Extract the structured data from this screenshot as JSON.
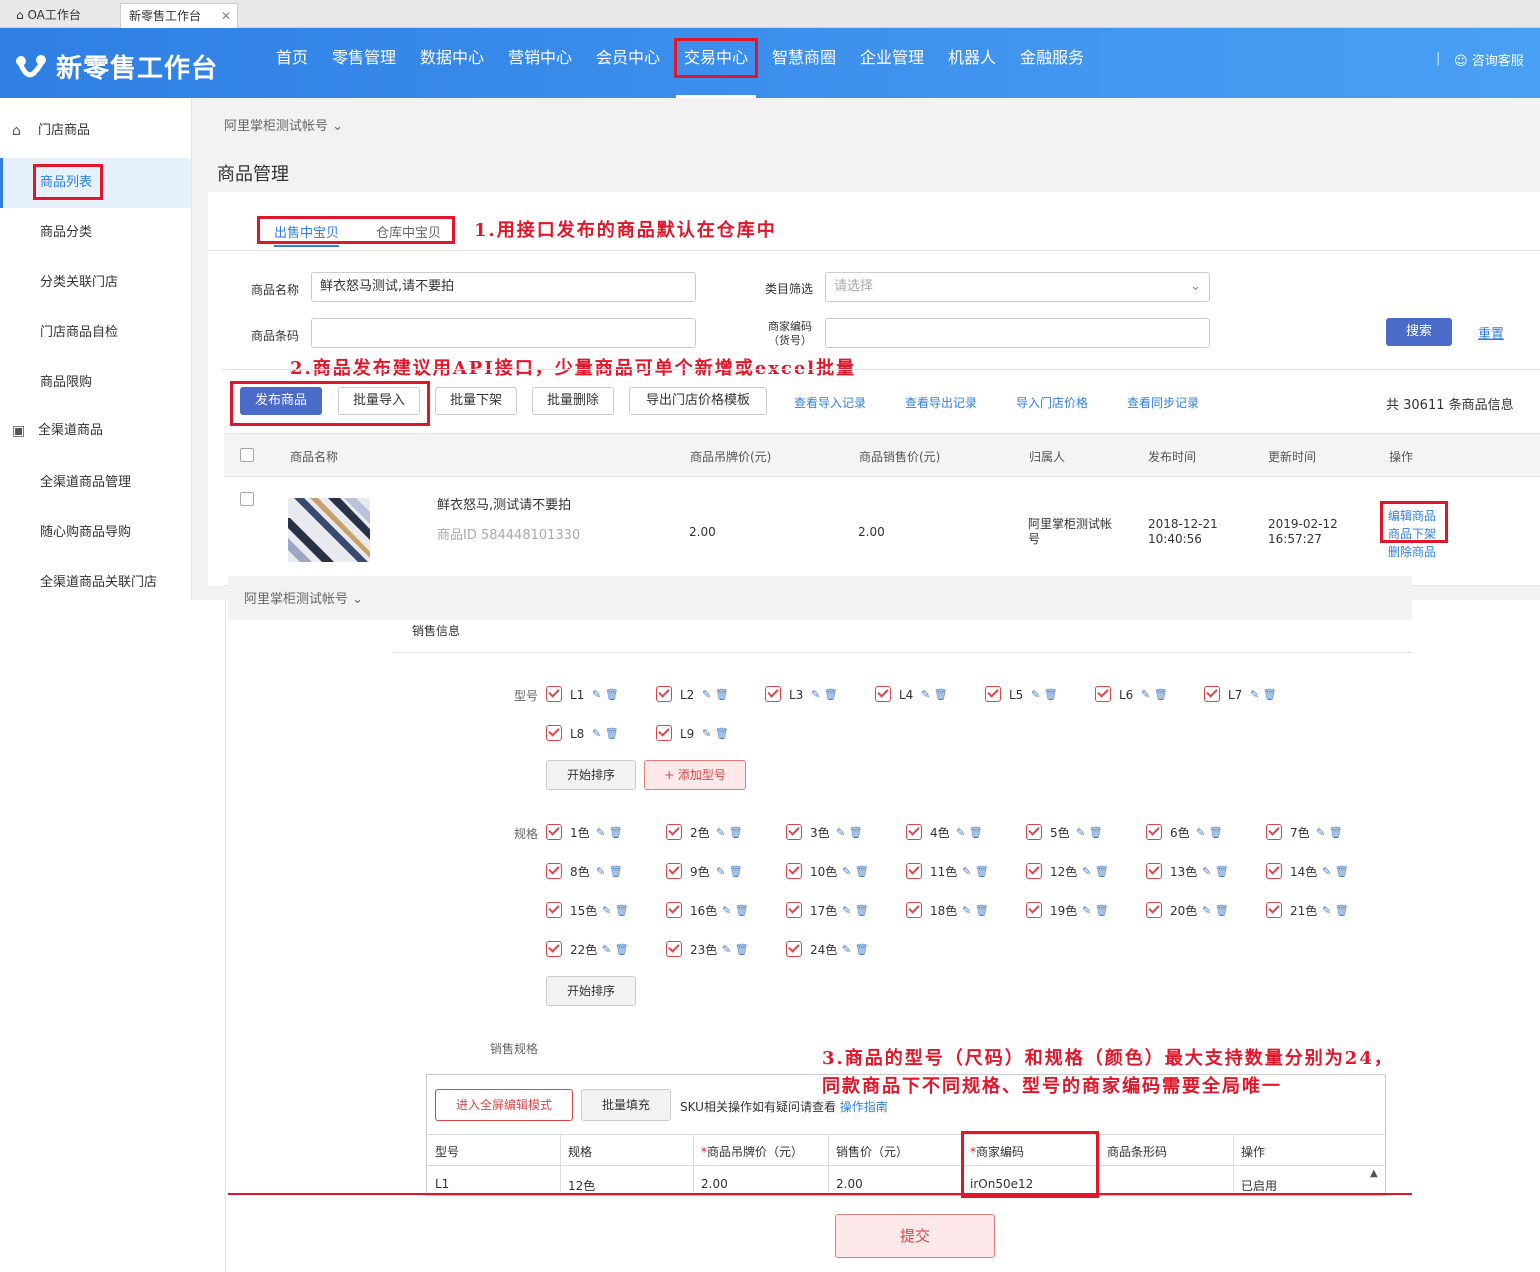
{
  "browser_tabs": [
    {
      "label": "OA工作台"
    },
    {
      "label": "新零售工作台"
    }
  ],
  "header": {
    "logo": "新零售工作台",
    "nav": [
      "首页",
      "零售管理",
      "数据中心",
      "营销中心",
      "会员中心",
      "交易中心",
      "智慧商圈",
      "企业管理",
      "机器人",
      "金融服务"
    ],
    "service": "咨询客服"
  },
  "sidebar": {
    "group1": "门店商品",
    "items1": [
      "商品列表",
      "商品分类",
      "分类关联门店",
      "门店商品自检",
      "商品限购"
    ],
    "group2": "全渠道商品",
    "items2": [
      "全渠道商品管理",
      "随心购商品导购",
      "全渠道商品关联门店"
    ]
  },
  "account": "阿里掌柜测试帐号",
  "page_title": "商品管理",
  "tabs": {
    "selling": "出售中宝贝",
    "warehouse": "仓库中宝贝"
  },
  "annotations": {
    "a1": "1.用接口发布的商品默认在仓库中",
    "a2": "2.商品发布建议用API接口，少量商品可单个新增或excel批量",
    "a3_line1": "3.商品的型号（尺码）和规格（颜色）最大支持数量分别为24，",
    "a3_line2": "同款商品下不同规格、型号的商家编码需要全局唯一"
  },
  "filters": {
    "name_label": "商品名称",
    "name_value": "鲜衣怒马测试,请不要拍",
    "category_label": "类目筛选",
    "category_placeholder": "请选择",
    "barcode_label": "商品条码",
    "merchant_code_label": "商家编码",
    "merchant_code_sub": "（货号）",
    "search": "搜索",
    "reset": "重置"
  },
  "toolbar": {
    "publish": "发布商品",
    "batch_import": "批量导入",
    "batch_offshelf": "批量下架",
    "batch_delete": "批量删除",
    "export_template": "导出门店价格模板",
    "links": [
      "查看导入记录",
      "查看导出记录",
      "导入门店价格",
      "查看同步记录"
    ],
    "total": "共 30611 条商品信息"
  },
  "table": {
    "headers": [
      "商品名称",
      "商品吊牌价(元)",
      "商品销售价(元)",
      "归属人",
      "发布时间",
      "更新时间",
      "操作"
    ],
    "row": {
      "name": "鲜衣怒马,测试请不要拍",
      "id": "商品ID 584448101330",
      "tag_price": "2.00",
      "sale_price": "2.00",
      "owner": "阿里掌柜测试帐号",
      "publish_time": "2018-12-21 10:40:56",
      "update_time": "2019-02-12 16:57:27",
      "actions": [
        "编辑商品",
        "商品下架",
        "删除商品"
      ]
    }
  },
  "edit": {
    "account": "阿里掌柜测试帐号",
    "sales_info": "销售信息",
    "model_label": "型号",
    "models": [
      "L1",
      "L2",
      "L3",
      "L4",
      "L5",
      "L6",
      "L7",
      "L8",
      "L9"
    ],
    "start_sort": "开始排序",
    "add_model": "+ 添加型号",
    "spec_label": "规格",
    "specs": [
      "1色",
      "2色",
      "3色",
      "4色",
      "5色",
      "6色",
      "7色",
      "8色",
      "9色",
      "10色",
      "11色",
      "12色",
      "13色",
      "14色",
      "15色",
      "16色",
      "17色",
      "18色",
      "19色",
      "20色",
      "21色",
      "22色",
      "23色",
      "24色"
    ],
    "sales_spec": "销售规格",
    "fullscreen": "进入全屏编辑模式",
    "batch_fill": "批量填充",
    "sku_help": "SKU相关操作如有疑问请查看",
    "guide": "操作指南",
    "sku_headers": [
      "型号",
      "规格",
      "商品吊牌价（元）",
      "销售价（元）",
      "商家编码",
      "商品条形码",
      "操作"
    ],
    "sku_row": [
      "L1",
      "12色",
      "2.00",
      "2.00",
      "irOn50e12",
      "",
      "已启用"
    ],
    "submit": "提交"
  }
}
